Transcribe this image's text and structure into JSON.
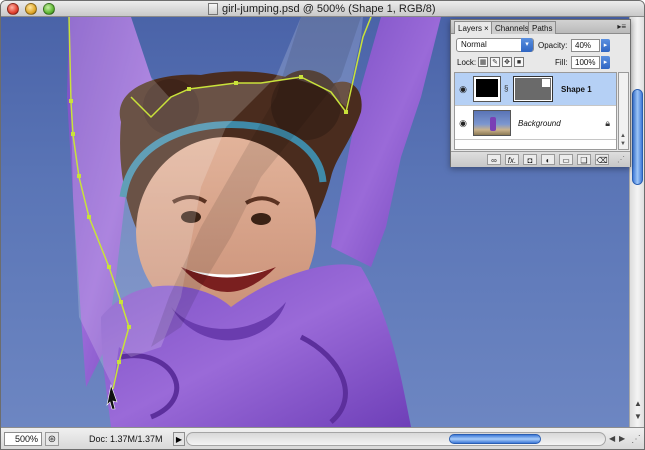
{
  "window": {
    "title": "girl-jumping.psd @ 500% (Shape 1, RGB/8)"
  },
  "layers_panel": {
    "tabs": [
      {
        "label": "Layers",
        "active": true
      },
      {
        "label": "Channels",
        "active": false
      },
      {
        "label": "Paths",
        "active": false
      }
    ],
    "tab_close_glyph": "×",
    "blend_mode": "Normal",
    "opacity_label": "Opacity:",
    "opacity_value": "40%",
    "lock_label": "Lock:",
    "fill_label": "Fill:",
    "fill_value": "100%",
    "layers": [
      {
        "name": "Shape 1",
        "selected": true,
        "thumbnail": "black-fill",
        "has_mask": true
      },
      {
        "name": "Background",
        "selected": false,
        "thumbnail": "photo",
        "locked": true
      }
    ],
    "bottom_buttons": [
      "link-icon",
      "fx-icon",
      "mask-icon",
      "adjustment-icon",
      "folder-icon",
      "new-layer-icon",
      "trash-icon"
    ],
    "fx_label": "fx."
  },
  "status_bar": {
    "zoom": "500%",
    "doc_size": "Doc: 1.37M/1.37M"
  },
  "colors": {
    "sky": "#5a75b6",
    "shirt": "#8a5bd0",
    "path_stroke": "#c9e23a",
    "selection": "#b5d0f5",
    "scroll_accent": "#3f7ad8"
  }
}
